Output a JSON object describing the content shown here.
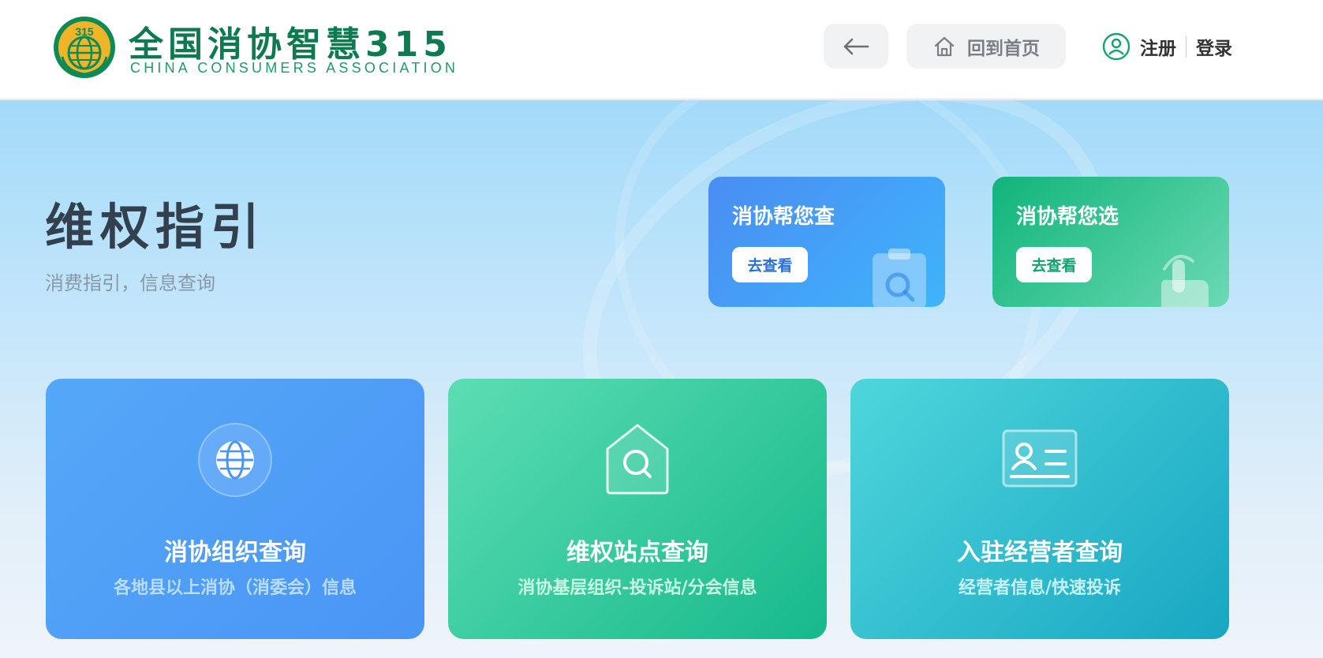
{
  "header": {
    "logo_title": "全国消协智慧315",
    "logo_subtitle": "CHINA CONSUMERS ASSOCIATION",
    "logo_emblem_text": "315",
    "back_icon": "arrow-left-icon",
    "home_icon": "home-icon",
    "home_label": "回到首页",
    "user_icon": "user-circle-icon",
    "register_label": "注册",
    "login_label": "登录"
  },
  "hero": {
    "title": "维权指引",
    "subtitle": "消费指引，信息查询"
  },
  "promos": [
    {
      "title": "消协帮您查",
      "button": "去查看",
      "icon": "search-document-icon",
      "color": "#4a8df2"
    },
    {
      "title": "消协帮您选",
      "button": "去查看",
      "icon": "pointing-hand-icon",
      "color": "#10b47a"
    }
  ],
  "cards": [
    {
      "title": "消协组织查询",
      "subtitle": "各地县以上消协（消委会）信息",
      "icon": "globe-icon",
      "color": "#4a95f5"
    },
    {
      "title": "维权站点查询",
      "subtitle": "消协基层组织-投诉站/分会信息",
      "icon": "house-search-icon",
      "color": "#16b98b"
    },
    {
      "title": "入驻经营者查询",
      "subtitle": "经营者信息/快速投诉",
      "icon": "id-card-icon",
      "color": "#18a6c2"
    }
  ],
  "colors": {
    "brand_green": "#0f7a4f",
    "emblem_yellow": "#f0b429"
  }
}
